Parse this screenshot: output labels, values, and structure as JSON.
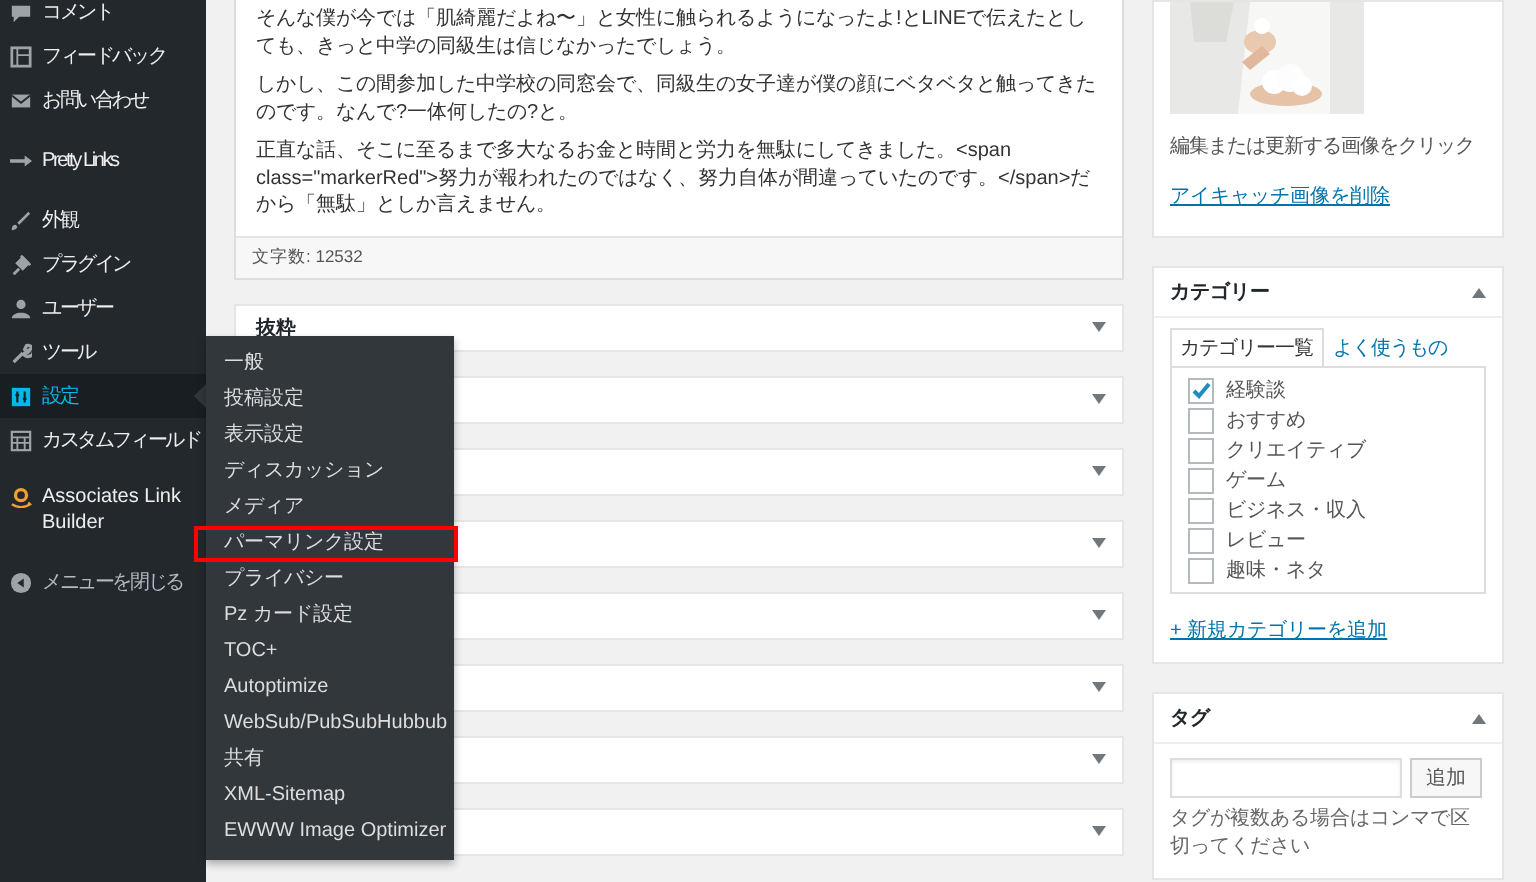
{
  "sidebar": {
    "items": [
      {
        "label": "コメント",
        "selected": false
      },
      {
        "label": "フィードバック",
        "selected": false
      },
      {
        "label": "お問い合わせ",
        "selected": false
      },
      {
        "label": "Pretty Links",
        "selected": false
      },
      {
        "label": "外観",
        "selected": false
      },
      {
        "label": "プラグイン",
        "selected": false
      },
      {
        "label": "ユーザー",
        "selected": false
      },
      {
        "label": "ツール",
        "selected": false
      },
      {
        "label": "設定",
        "selected": true
      },
      {
        "label": "カスタムフィールド",
        "selected": false
      },
      {
        "label": "Associates Link Builder",
        "selected": false
      },
      {
        "label": "メニューを閉じる",
        "selected": false
      }
    ]
  },
  "submenu": {
    "items": [
      {
        "label": "一般",
        "highlighted": false
      },
      {
        "label": "投稿設定",
        "highlighted": false
      },
      {
        "label": "表示設定",
        "highlighted": false
      },
      {
        "label": "ディスカッション",
        "highlighted": false
      },
      {
        "label": "メディア",
        "highlighted": false
      },
      {
        "label": "パーマリンク設定",
        "highlighted": true
      },
      {
        "label": "プライバシー",
        "highlighted": false
      },
      {
        "label": "Pz カード設定",
        "highlighted": false
      },
      {
        "label": "TOC+",
        "highlighted": false
      },
      {
        "label": "Autoptimize",
        "highlighted": false
      },
      {
        "label": "WebSub/PubSubHubbub",
        "highlighted": false
      },
      {
        "label": "共有",
        "highlighted": false
      },
      {
        "label": "XML-Sitemap",
        "highlighted": false
      },
      {
        "label": "EWWW Image Optimizer",
        "highlighted": false
      }
    ]
  },
  "editor": {
    "paragraphs": [
      "そんな僕が今では「肌綺麗だよね〜」と女性に触られるようになったよ!とLINEで伝えたとしても、きっと中学の同級生は信じなかったでしょう。",
      "しかし、この間参加した中学校の同窓会で、同級生の女子達が僕の顔にベタベタと触ってきたのです。なんで?一体何したの?と。",
      "正直な話、そこに至るまで多大なるお金と時間と労力を無駄にしてきました。<span class=\"markerRed\">努力が報われたのではなく、努力自体が間違っていたのです。</span>だから「無駄」としか言えません。"
    ],
    "word_count": "文字数: 12532"
  },
  "postboxes": [
    {
      "title": "抜粋",
      "expanded": false
    },
    {
      "expanded": false
    },
    {
      "expanded": false
    },
    {
      "expanded": false
    },
    {
      "expanded": false
    },
    {
      "expanded": false
    },
    {
      "expanded": false
    },
    {
      "expanded": false
    }
  ],
  "featured_image": {
    "caption": "編集または更新する画像をクリック",
    "remove_link": "アイキャッチ画像を削除"
  },
  "categories": {
    "title": "カテゴリー",
    "expanded": true,
    "tabs": [
      {
        "label": "カテゴリー一覧",
        "selected": true
      },
      {
        "label": "よく使うもの",
        "selected": false
      }
    ],
    "items": [
      {
        "label": "経験談",
        "checked": true
      },
      {
        "label": "おすすめ",
        "checked": false
      },
      {
        "label": "クリエイティブ",
        "checked": false
      },
      {
        "label": "ゲーム",
        "checked": false
      },
      {
        "label": "ビジネス・収入",
        "checked": false
      },
      {
        "label": "レビュー",
        "checked": false
      },
      {
        "label": "趣味・ネタ",
        "checked": false
      }
    ],
    "add_link": "+ 新規カテゴリーを追加"
  },
  "tags": {
    "title": "タグ",
    "expanded": true,
    "add_button": "追加",
    "help": "タグが複数ある場合はコンマで区切ってください"
  }
}
